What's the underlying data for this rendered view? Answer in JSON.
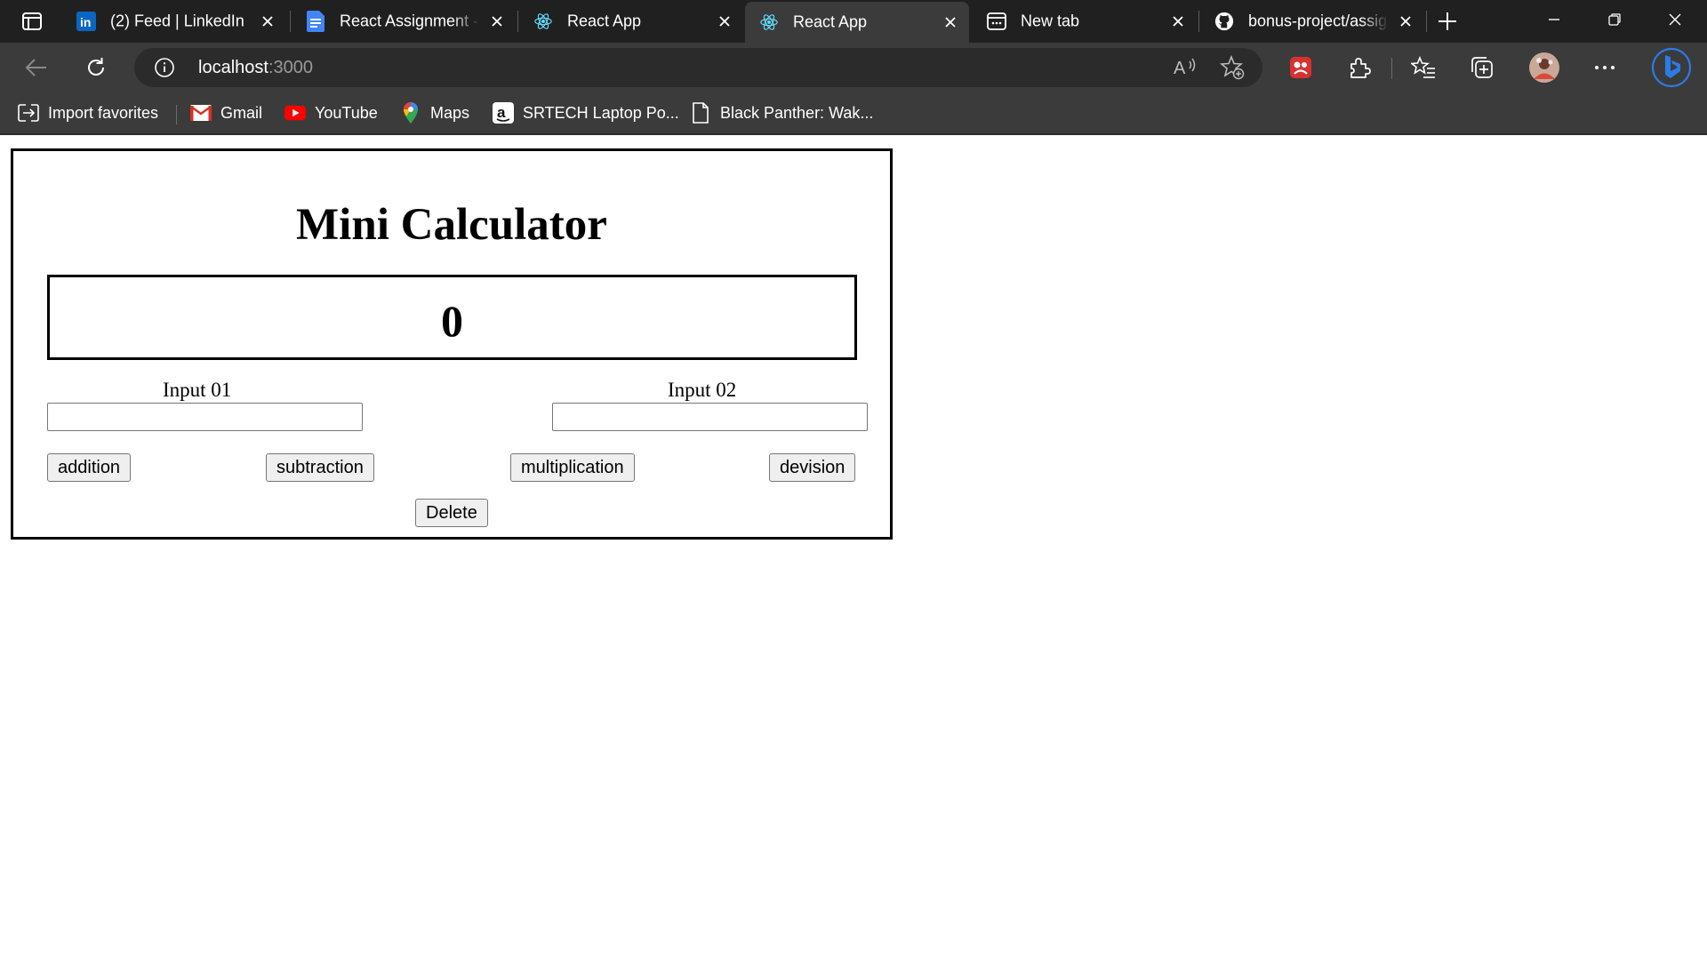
{
  "browser": {
    "tabs": [
      {
        "title": "(2) Feed | LinkedIn",
        "icon": "linkedin-icon",
        "active": false
      },
      {
        "title": "React Assignment - ",
        "icon": "google-docs-icon",
        "active": false
      },
      {
        "title": "React App",
        "icon": "react-icon",
        "active": false
      },
      {
        "title": "React App",
        "icon": "react-icon",
        "active": true
      },
      {
        "title": "New tab",
        "icon": "new-tab-page-icon",
        "active": false
      },
      {
        "title": "bonus-project/assig",
        "icon": "github-icon",
        "active": false
      }
    ],
    "address": {
      "host": "localhost",
      "port": ":3000"
    },
    "favorites": [
      {
        "label": "Import favorites",
        "icon": "import-favorites-icon"
      },
      {
        "label": "Gmail",
        "icon": "gmail-icon"
      },
      {
        "label": "YouTube",
        "icon": "youtube-icon"
      },
      {
        "label": "Maps",
        "icon": "maps-pin-icon"
      },
      {
        "label": "SRTECH Laptop Po...",
        "icon": "amazon-icon"
      },
      {
        "label": "Black Panther: Wak...",
        "icon": "page-icon"
      }
    ],
    "read_aloud_label": "A",
    "colors": {
      "tabstrip": "#202020",
      "toolbar": "#3b3b3b",
      "omnibox": "#2b2b2b",
      "copilot_blue": "#2b7be6"
    }
  },
  "calculator": {
    "title": "Mini Calculator",
    "result": "0",
    "input1": {
      "label": "Input 01",
      "value": ""
    },
    "input2": {
      "label": "Input 02",
      "value": ""
    },
    "buttons": {
      "addition": "addition",
      "subtraction": "subtraction",
      "multiplication": "multiplication",
      "division": "devision",
      "delete": "Delete"
    }
  }
}
